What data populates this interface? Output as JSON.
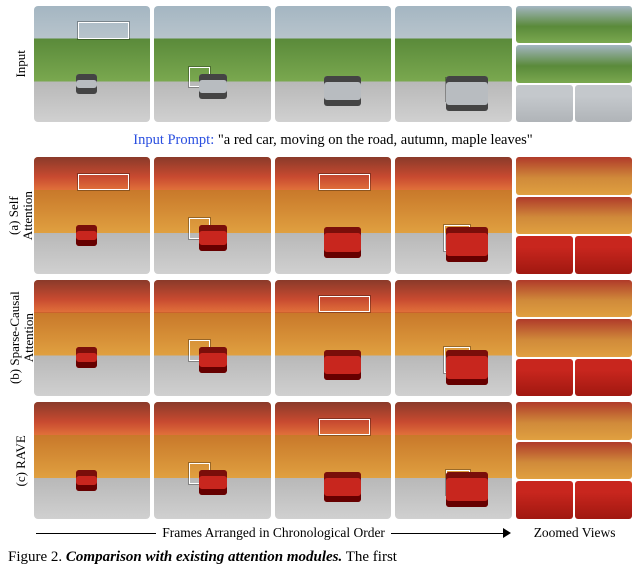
{
  "row_labels": {
    "input": "Input",
    "a": "(a) Self\nAttention",
    "b": "(b) Sparse-Causal\nAttention",
    "c": "(c) RAVE"
  },
  "prompt": {
    "prefix": "Input Prompt:",
    "text": "\"a red car, moving on the road, autumn, maple leaves\""
  },
  "axis": {
    "frames_label": "Frames Arranged in Chronological Order",
    "zoom_label": "Zoomed Views"
  },
  "caption": {
    "fig_label": "Figure 2.",
    "title": "Comparison with existing attention modules.",
    "trailing": "The first"
  }
}
